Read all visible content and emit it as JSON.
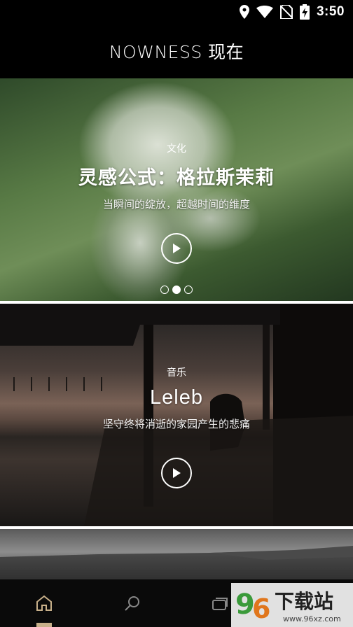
{
  "status_bar": {
    "time": "3:50",
    "icons": [
      "location-icon",
      "wifi-icon",
      "no-sim-icon",
      "battery-charging-icon"
    ]
  },
  "app_bar": {
    "title": "NOWNESS 现在"
  },
  "feed": {
    "featured": {
      "category": "文化",
      "title": "灵感公式：格拉斯茉莉",
      "subtitle": "当瞬间的绽放，超越时间的维度",
      "carousel_pages": 3,
      "carousel_active_index": 1
    },
    "items": [
      {
        "category": "音乐",
        "title": "Leleb",
        "subtitle": "坚守终将消逝的家园产生的悲痛"
      }
    ]
  },
  "bottom_nav": {
    "items": [
      {
        "icon": "home-icon",
        "active": true
      },
      {
        "icon": "search-icon",
        "active": false
      },
      {
        "icon": "collections-icon",
        "active": false
      },
      {
        "icon": "profile-icon",
        "active": false
      }
    ],
    "accent_color": "#c8b08a"
  },
  "watermark": {
    "brand": "96下载站",
    "url": "www.96xz.com"
  }
}
